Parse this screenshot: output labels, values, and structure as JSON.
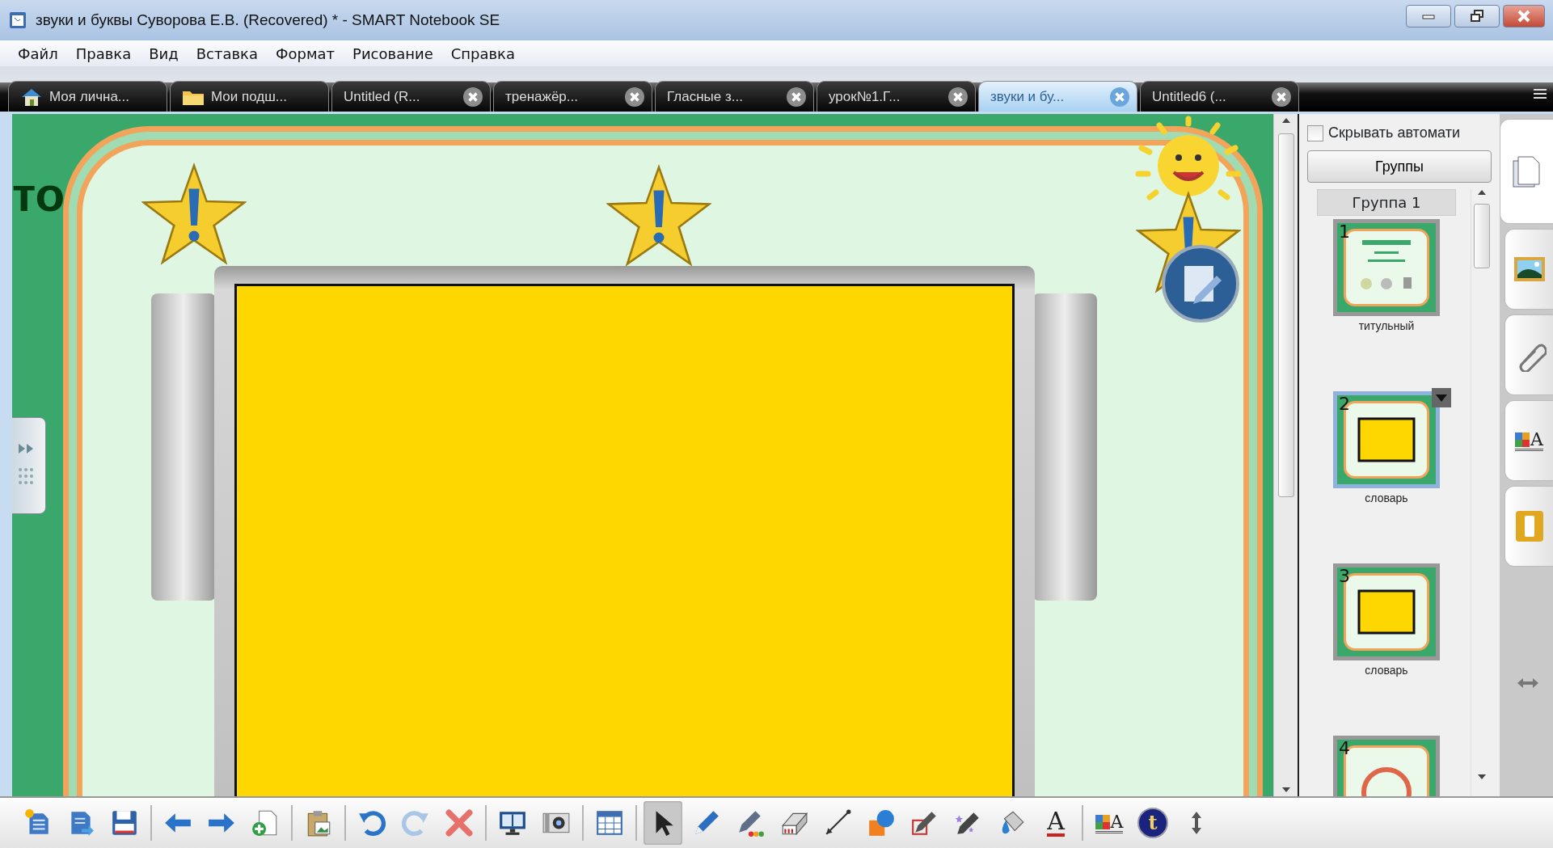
{
  "window": {
    "title": "звуки и буквы Суворова Е.В. (Recovered) * - SMART Notebook SE"
  },
  "menu": [
    "Файл",
    "Правка",
    "Вид",
    "Вставка",
    "Формат",
    "Рисование",
    "Справка"
  ],
  "tabs": [
    {
      "label": "Моя лична...",
      "kind": "home",
      "selected": false
    },
    {
      "label": "Мои подш...",
      "kind": "folder",
      "selected": false
    },
    {
      "label": "Untitled (R...",
      "kind": "closable",
      "selected": false
    },
    {
      "label": "тренажёр...",
      "kind": "closable",
      "selected": false
    },
    {
      "label": "Гласные з...",
      "kind": "closable",
      "selected": false
    },
    {
      "label": "урок№1.Г...",
      "kind": "closable",
      "selected": false
    },
    {
      "label": "звуки и бу...",
      "kind": "closable",
      "selected": true
    },
    {
      "label": "Untitled6 (...",
      "kind": "closable",
      "selected": false
    }
  ],
  "canvas": {
    "heading_fragment": "то"
  },
  "side_panel": {
    "auto_hide": {
      "label": "Скрывать автомати",
      "checked": false
    },
    "groups_button": "Группы",
    "group_title": "Группа 1",
    "pages": [
      {
        "number": "1",
        "name": "титульный",
        "kind": "title",
        "selected": false
      },
      {
        "number": "2",
        "name": "словарь",
        "kind": "board",
        "selected": true
      },
      {
        "number": "3",
        "name": "словарь",
        "kind": "board",
        "selected": false
      },
      {
        "number": "4",
        "kind": "circle",
        "selected": false
      }
    ]
  },
  "side_tabs": [
    {
      "kind": "pages",
      "selected": true
    },
    {
      "kind": "gallery",
      "selected": false
    },
    {
      "kind": "attachments",
      "selected": false
    },
    {
      "kind": "properties",
      "glyph": "A",
      "selected": false
    },
    {
      "kind": "addons",
      "selected": false
    }
  ],
  "toolbar": {
    "groups": [
      [
        {
          "kind": "new",
          "selected": false
        },
        {
          "kind": "open",
          "selected": false
        },
        {
          "kind": "save",
          "selected": false
        }
      ],
      [
        {
          "kind": "back",
          "selected": false
        },
        {
          "kind": "forward",
          "selected": false
        },
        {
          "kind": "add-page",
          "selected": false
        }
      ],
      [
        {
          "kind": "paste",
          "selected": false
        }
      ],
      [
        {
          "kind": "undo",
          "selected": false
        },
        {
          "kind": "redo",
          "selected": false
        },
        {
          "kind": "delete",
          "selected": false
        }
      ],
      [
        {
          "kind": "screen",
          "selected": false
        },
        {
          "kind": "camera",
          "selected": false
        }
      ],
      [
        {
          "kind": "table",
          "selected": false
        }
      ],
      [
        {
          "kind": "select",
          "selected": true
        },
        {
          "kind": "pen",
          "selected": false
        },
        {
          "kind": "creative-pen",
          "selected": false
        },
        {
          "kind": "eraser",
          "selected": false
        },
        {
          "kind": "line",
          "selected": false
        },
        {
          "kind": "shapes",
          "selected": false
        },
        {
          "kind": "shape-pen",
          "selected": false
        },
        {
          "kind": "magic-pen",
          "selected": false
        },
        {
          "kind": "fill",
          "selected": false
        },
        {
          "kind": "text",
          "glyph": "A",
          "selected": false
        }
      ],
      [
        {
          "kind": "properties",
          "glyph": "A",
          "selected": false
        },
        {
          "kind": "tools",
          "glyph": "t",
          "selected": false
        },
        {
          "kind": "move",
          "selected": false
        }
      ]
    ]
  }
}
